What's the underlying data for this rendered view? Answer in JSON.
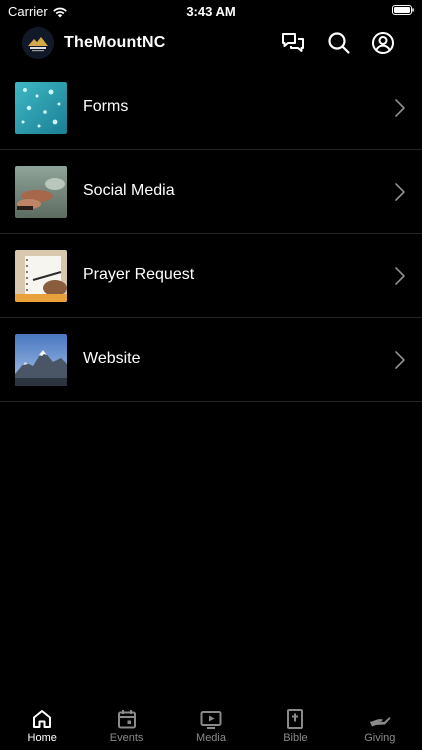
{
  "status_bar": {
    "carrier": "Carrier",
    "time": "3:43 AM"
  },
  "header": {
    "title": "TheMountNC",
    "logo_icon": "church-logo-icon",
    "actions": [
      "chat-icon",
      "search-icon",
      "account-icon"
    ]
  },
  "list": {
    "items": [
      {
        "label": "Forms",
        "thumb": "water-drops-image"
      },
      {
        "label": "Social Media",
        "thumb": "hands-image"
      },
      {
        "label": "Prayer Request",
        "thumb": "notebook-image"
      },
      {
        "label": "Website",
        "thumb": "mountain-image"
      }
    ]
  },
  "tabs": [
    {
      "label": "Home",
      "icon": "home-icon",
      "active": true
    },
    {
      "label": "Events",
      "icon": "calendar-icon",
      "active": false
    },
    {
      "label": "Media",
      "icon": "play-icon",
      "active": false
    },
    {
      "label": "Bible",
      "icon": "bible-icon",
      "active": false
    },
    {
      "label": "Giving",
      "icon": "giving-hand-icon",
      "active": false
    }
  ],
  "colors": {
    "background": "#000000",
    "text": "#ffffff",
    "inactive_tab": "#8a8a8a",
    "divider": "#262626"
  }
}
